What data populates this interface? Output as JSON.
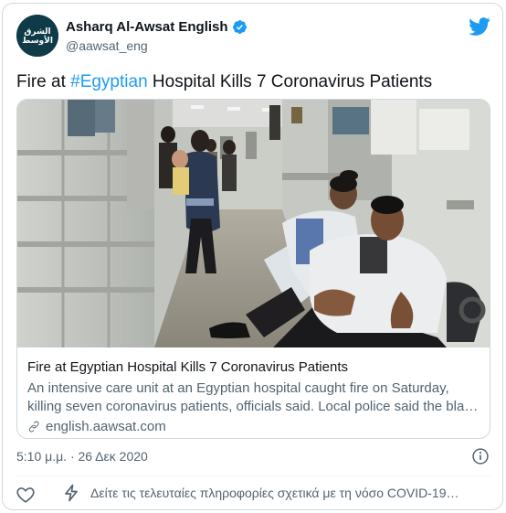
{
  "author": {
    "display_name": "Asharq Al-Awsat English",
    "handle": "@aawsat_eng",
    "logo_text_line1": "الشرق",
    "logo_text_line2": "الأوسط"
  },
  "tweet": {
    "text_before": "Fire at ",
    "hashtag": "#Egyptian",
    "text_after": " Hospital Kills 7 Coronavirus Patients",
    "timestamp": "5:10 μ.μ. · 26 Δεκ 2020"
  },
  "link_card": {
    "title": "Fire at Egyptian Hospital Kills 7 Coronavirus Patients",
    "description_line1": "An intensive care unit at an Egyptian hospital caught fire on Saturday,",
    "description_line2": "killing seven coronavirus patients, officials said. Local police said the blaze started in the ICU…",
    "domain": "english.aawsat.com"
  },
  "footer": {
    "covid_notice": "Δείτε τις τελευταίες πληροφορίες σχετικά με τη νόσο COVID-19…"
  },
  "icons": {
    "bird": "twitter-bird-icon",
    "verified": "verified-badge-icon",
    "link": "link-icon",
    "info": "info-icon",
    "heart": "heart-icon",
    "bolt": "lightning-icon"
  },
  "colors": {
    "twitter_blue": "#1d9bf0",
    "secondary_text": "#536471",
    "border": "#cfd9de"
  }
}
